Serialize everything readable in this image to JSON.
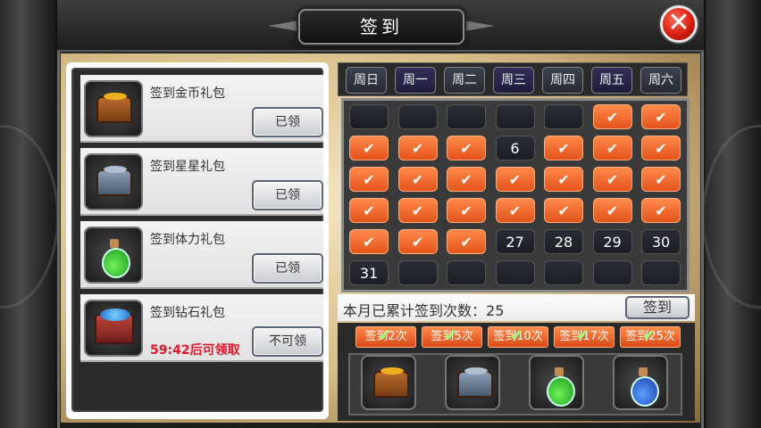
{
  "window": {
    "title": "签到",
    "close_icon": "close-icon"
  },
  "gifts": [
    {
      "name": "签到金币礼包",
      "icon": "gold-chest-icon",
      "button": "已领",
      "timer": ""
    },
    {
      "name": "签到星星礼包",
      "icon": "silver-chest-icon",
      "button": "已领",
      "timer": ""
    },
    {
      "name": "签到体力礼包",
      "icon": "green-potion-icon",
      "button": "已领",
      "timer": ""
    },
    {
      "name": "签到钻石礼包",
      "icon": "diamond-chest-icon",
      "button": "不可领",
      "timer": "59:42后可领取"
    }
  ],
  "weekdays": [
    "周日",
    "周一",
    "周二",
    "周三",
    "周四",
    "周五",
    "周六"
  ],
  "calendar": {
    "rows": [
      [
        "",
        "",
        "",
        "",
        "",
        "✔",
        "✔"
      ],
      [
        "✔",
        "✔",
        "✔",
        "6",
        "✔",
        "✔",
        "✔"
      ],
      [
        "✔",
        "✔",
        "✔",
        "✔",
        "✔",
        "✔",
        "✔"
      ],
      [
        "✔",
        "✔",
        "✔",
        "✔",
        "✔",
        "✔",
        "✔"
      ],
      [
        "✔",
        "✔",
        "✔",
        "27",
        "28",
        "29",
        "30"
      ],
      [
        "31",
        "",
        "",
        "",
        "",
        "",
        ""
      ]
    ]
  },
  "summary": {
    "label": "本月已累计签到次数：",
    "count": "25",
    "sign_button": "签到"
  },
  "milestones": [
    {
      "label": "签到2次",
      "check": "✔"
    },
    {
      "label": "签到5次",
      "check": "✔"
    },
    {
      "label": "签到10次",
      "check": "✔"
    },
    {
      "label": "签到17次",
      "check": "✔"
    },
    {
      "label": "签到25次",
      "check": "✔"
    }
  ],
  "rewards": [
    {
      "icon": "gold-chest-icon"
    },
    {
      "icon": "silver-chest-icon"
    },
    {
      "icon": "green-potion-icon"
    },
    {
      "icon": "blue-potion-icon"
    }
  ],
  "colors": {
    "signed_cell": "#e3531a",
    "accent_red": "#e0162a",
    "close_button": "#d81e12"
  }
}
